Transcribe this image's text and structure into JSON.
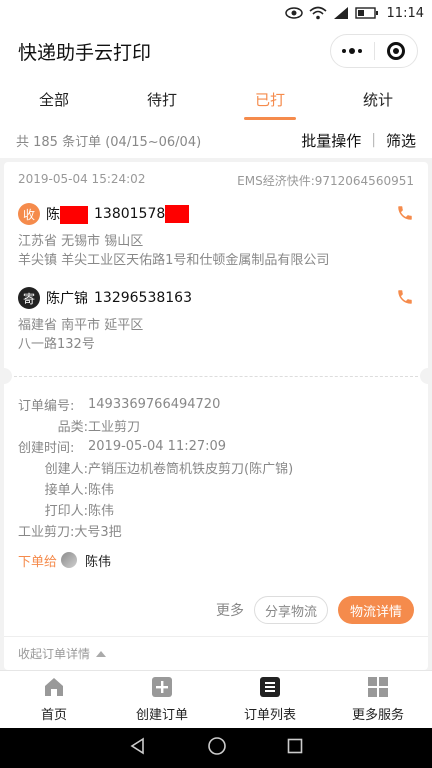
{
  "status_bar": {
    "time": "11:14"
  },
  "app": {
    "title": "快递助手云打印"
  },
  "tabs": [
    {
      "label": "全部",
      "active": false
    },
    {
      "label": "待打",
      "active": false
    },
    {
      "label": "已打",
      "active": true
    },
    {
      "label": "统计",
      "active": false
    }
  ],
  "summary": {
    "count_text": "共 185 条订单 (04/15~06/04)",
    "batch_label": "批量操作",
    "filter_label": "筛选"
  },
  "order": {
    "datetime": "2019-05-04 15:24:02",
    "tracking": "EMS经济快件:9712064560951",
    "receiver": {
      "badge": "收",
      "name": "陈",
      "phone": "13801578",
      "region": "江苏省 无锡市 锡山区",
      "address": "羊尖镇 羊尖工业区天佑路1号和仕顿金属制品有限公司"
    },
    "sender": {
      "badge": "寄",
      "name": "陈广锦",
      "phone": "13296538163",
      "region": "福建省 南平市 延平区",
      "address": "八一路132号"
    },
    "details": {
      "order_no_label": "订单编号:",
      "order_no": "1493369766494720",
      "category_label": "品类:",
      "category": "工业剪刀",
      "created_label": "创建时间:",
      "created": "2019-05-04 11:27:09",
      "creator_label": "创建人:",
      "creator": "产销压边机卷筒机铁皮剪刀(陈广锦)",
      "taker_label": "接单人:",
      "taker": "陈伟",
      "printer_label": "打印人:",
      "printer": "陈伟",
      "note": "工业剪刀:大号3把",
      "assign_label": "下单给",
      "assign_name": "陈伟"
    },
    "actions": {
      "more": "更多",
      "share": "分享物流",
      "logistics": "物流详情"
    },
    "collapse_label": "收起订单详情"
  },
  "bottom_nav": [
    {
      "label": "首页",
      "icon": "home-icon"
    },
    {
      "label": "创建订单",
      "icon": "add-order-icon"
    },
    {
      "label": "订单列表",
      "icon": "order-list-icon"
    },
    {
      "label": "更多服务",
      "icon": "grid-icon"
    }
  ],
  "colors": {
    "accent": "#f58b4c"
  }
}
